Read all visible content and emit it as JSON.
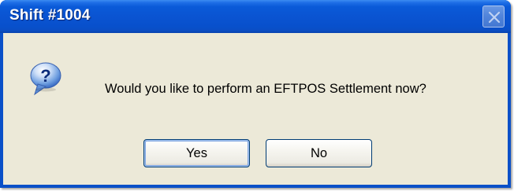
{
  "window": {
    "title": "Shift #1004"
  },
  "dialog": {
    "message": "Would you like to perform an EFTPOS Settlement now?",
    "icon": "question-icon"
  },
  "buttons": {
    "yes_label": "Yes",
    "no_label": "No"
  },
  "colors": {
    "titlebar": "#0a54d2",
    "client_background": "#ece9d8",
    "button_border": "#003c74"
  }
}
